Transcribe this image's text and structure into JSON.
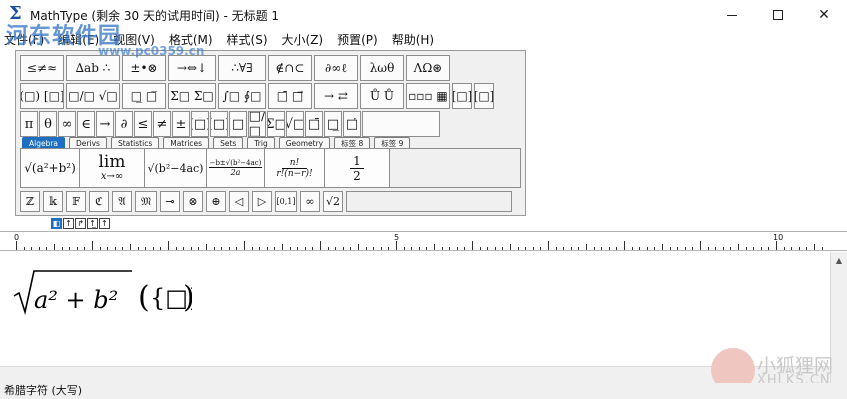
{
  "window": {
    "title": "MathType (剩余 30 天的试用时间) - 无标题 1",
    "app_icon": "Σ"
  },
  "menu": [
    "文件(F)",
    "编辑(E)",
    "视图(V)",
    "格式(M)",
    "样式(S)",
    "大小(Z)",
    "预置(P)",
    "帮助(H)"
  ],
  "symbol_palettes": [
    [
      "≤≠≈",
      "∆ab ∴",
      "±•⊗",
      "→⇔↓",
      "∴∀∃",
      "∉∩⊂",
      "∂∞ℓ",
      "λωθ",
      "ΛΩ⊛"
    ],
    [
      "(□) [□]",
      "□/□ √□",
      "□̲ □̅",
      "Σ□ Σ□",
      "∫□ ∮□",
      "□̄ □⃗",
      "→ ⇄",
      "Ů Ů",
      "▫▫▫ ▦"
    ]
  ],
  "palette_extra": [
    "[□]",
    "[□]"
  ],
  "small_symbols": [
    "π",
    "θ",
    "∞",
    "∈",
    "→",
    "∂",
    "≤",
    "≠",
    "±",
    "(□)",
    "[□]",
    "{□}",
    "□/□",
    "Σ□",
    "√□",
    "□̄",
    "□̲",
    "□̇"
  ],
  "tabs": [
    "Algebra",
    "Derivs",
    "Statistics",
    "Matrices",
    "Sets",
    "Trig",
    "Geometry",
    "标签 8",
    "标签 9"
  ],
  "templates": {
    "t1": "√(a²+b²)",
    "t2_top": "lim",
    "t2_bottom": "x→∞",
    "t3": "√(b²−4ac)",
    "t4_num": "−b±√(b²−4ac)",
    "t4_den": "2a",
    "t5_num": "n!",
    "t5_den": "r!(n−r)!",
    "t6_num": "1",
    "t6_den": "2"
  },
  "small_templates": [
    "ℤ",
    "𝕜",
    "𝔽",
    "ℭ",
    "𝔄",
    "𝔐",
    "⊸",
    "⊗",
    "⊕",
    "◁",
    "▷",
    "[0,1]",
    "∞",
    "√2"
  ],
  "nudge": [
    "◧",
    "↑",
    "↱",
    "↑̲",
    "↑"
  ],
  "ruler": {
    "labels": [
      "0",
      "5",
      "10"
    ]
  },
  "equation": {
    "radicand": "a² + b²",
    "placeholder": "{□}"
  },
  "status": "希腊字符 (大写)",
  "watermark": {
    "logo_text": "河东软件园",
    "logo_url": "www.pc0359.cn",
    "fox_cn": "小狐狸网",
    "fox_en": "XHLKS.CN"
  },
  "colors": {
    "accent": "#1e6fc2"
  }
}
